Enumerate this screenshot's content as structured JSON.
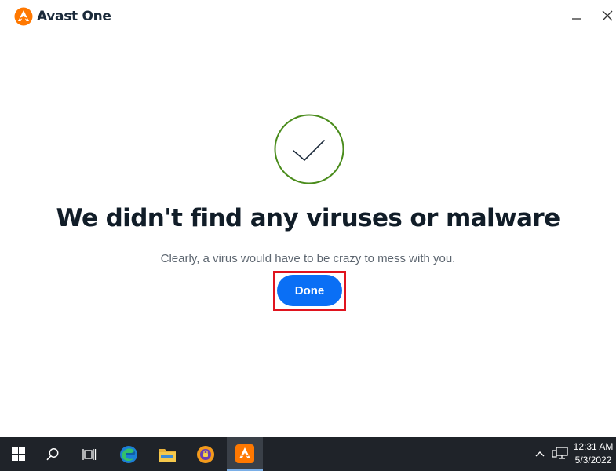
{
  "app": {
    "title": "Avast One",
    "brand_color": "#ff7800"
  },
  "result": {
    "icon": "checkmark-circle-icon",
    "headline": "We didn't find any viruses or malware",
    "subtext": "Clearly, a virus would have to be crazy to mess with you.",
    "done_label": "Done"
  },
  "window_controls": {
    "minimize": "minimize-icon",
    "close": "close-icon"
  },
  "taskbar": {
    "items": [
      {
        "name": "start-button",
        "icon": "windows-logo-icon"
      },
      {
        "name": "search-button",
        "icon": "search-icon"
      },
      {
        "name": "task-view-button",
        "icon": "task-view-icon"
      },
      {
        "name": "edge-button",
        "icon": "edge-icon"
      },
      {
        "name": "file-explorer-button",
        "icon": "folder-icon"
      },
      {
        "name": "avast-secure-browser-button",
        "icon": "avast-browser-icon"
      },
      {
        "name": "avast-one-button",
        "icon": "avast-one-icon",
        "active": true
      }
    ],
    "clock": {
      "time": "12:31 AM",
      "date": "5/3/2022"
    }
  },
  "colors": {
    "accent": "#0a6ff5",
    "success": "#4a8c1c",
    "highlight": "#e0141e",
    "taskbar": "#1f2329"
  }
}
